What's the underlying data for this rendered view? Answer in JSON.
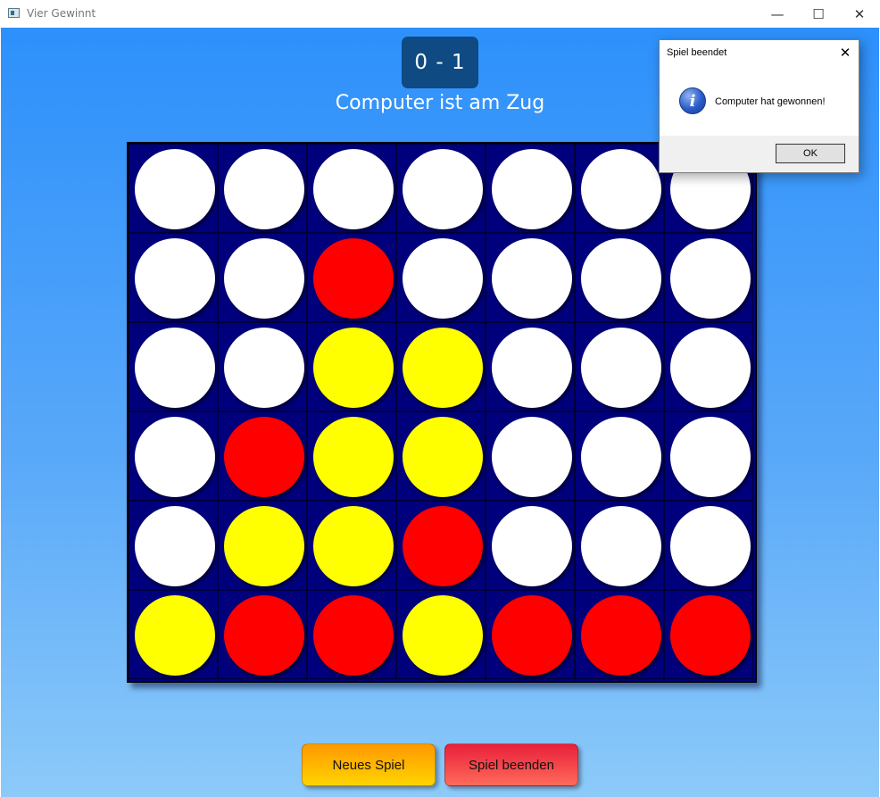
{
  "window": {
    "title": "Vier Gewinnt",
    "controls": {
      "minimize": "—",
      "maximize": "☐",
      "close": "✕"
    }
  },
  "game": {
    "score": "0 - 1",
    "status": "Computer ist am Zug",
    "board": [
      [
        "e",
        "e",
        "e",
        "e",
        "e",
        "e",
        "e"
      ],
      [
        "e",
        "e",
        "r",
        "e",
        "e",
        "e",
        "e"
      ],
      [
        "e",
        "e",
        "y",
        "y",
        "e",
        "e",
        "e"
      ],
      [
        "e",
        "r",
        "y",
        "y",
        "e",
        "e",
        "e"
      ],
      [
        "e",
        "y",
        "y",
        "r",
        "e",
        "e",
        "e"
      ],
      [
        "y",
        "r",
        "r",
        "y",
        "r",
        "r",
        "r"
      ]
    ],
    "colors": {
      "empty": "#ffffff",
      "red": "#ff0000",
      "yellow": "#ffff00",
      "board": "#00007d"
    }
  },
  "buttons": {
    "new_game": "Neues Spiel",
    "quit_game": "Spiel beenden"
  },
  "dialog": {
    "title": "Spiel beendet",
    "close": "✕",
    "icon": "i",
    "message": "Computer hat gewonnen!",
    "ok": "OK"
  }
}
